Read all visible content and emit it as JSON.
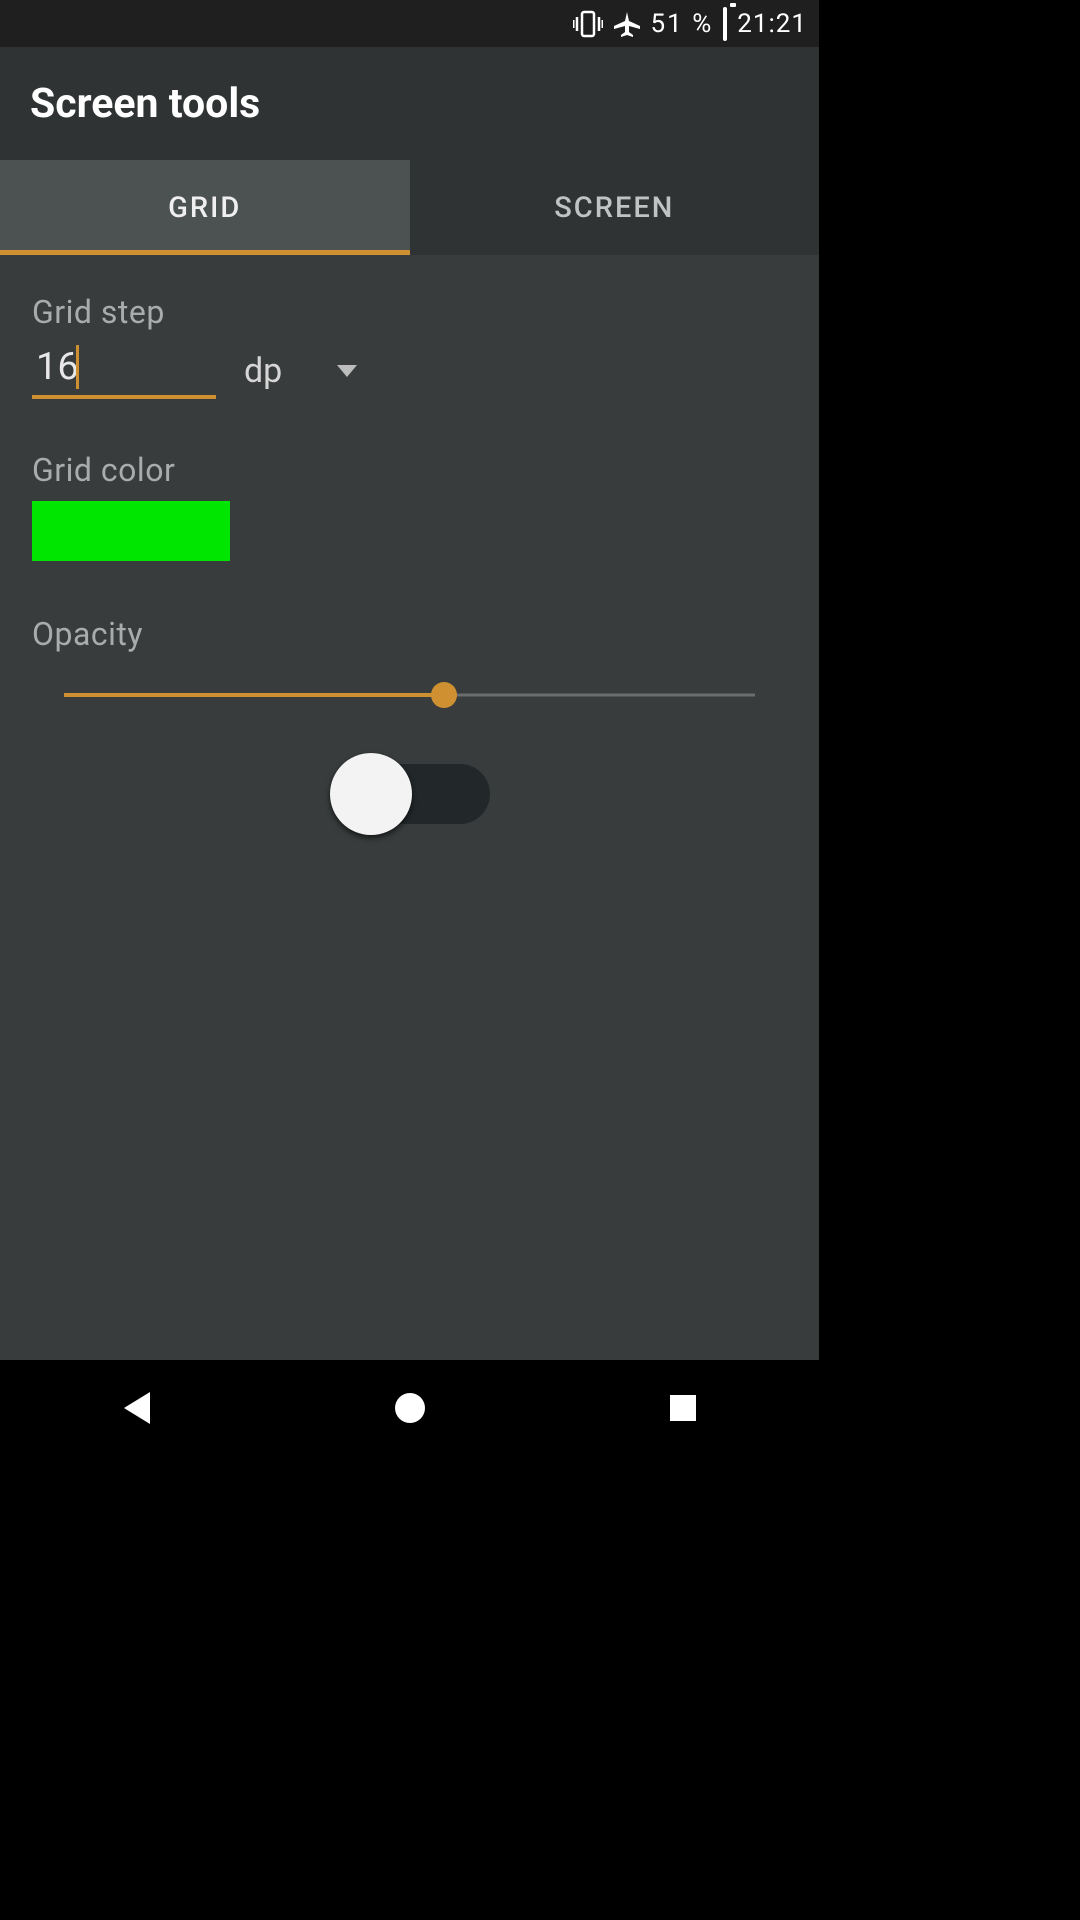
{
  "status": {
    "battery_pct": "51 %",
    "time": "21:21"
  },
  "header": {
    "title": "Screen tools"
  },
  "tabs": [
    {
      "label": "GRID",
      "active": true
    },
    {
      "label": "SCREEN",
      "active": false
    }
  ],
  "grid_step": {
    "label": "Grid step",
    "value": "16",
    "unit": "dp"
  },
  "grid_color": {
    "label": "Grid color",
    "hex": "#00e600"
  },
  "opacity": {
    "label": "Opacity",
    "percent": 55
  },
  "switch": {
    "on": false
  }
}
